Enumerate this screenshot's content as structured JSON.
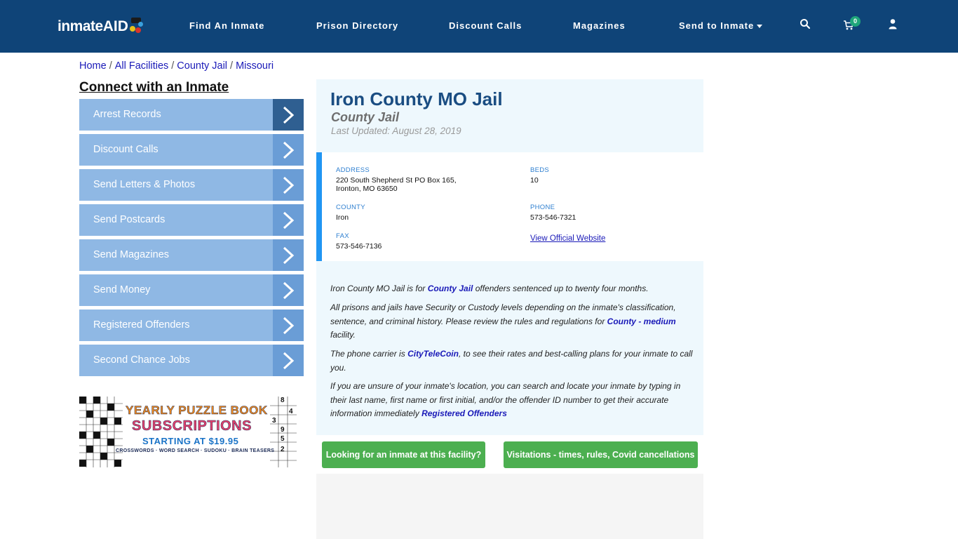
{
  "header": {
    "logo_text": "inmate",
    "logo_accent": "AID",
    "nav": [
      {
        "label": "Find An Inmate"
      },
      {
        "label": "Prison Directory"
      },
      {
        "label": "Discount Calls"
      },
      {
        "label": "Magazines"
      },
      {
        "label": "Send to Inmate"
      }
    ],
    "cart_count": "0",
    "icons": [
      "search-icon",
      "cart-icon",
      "user-icon",
      "chevron-down-icon"
    ]
  },
  "breadcrumb": {
    "items": [
      "Home",
      "All Facilities",
      "County Jail",
      "Missouri"
    ],
    "separator": "/"
  },
  "sidebar": {
    "title": "Connect with an Inmate",
    "items": [
      {
        "label": "Arrest Records"
      },
      {
        "label": "Discount Calls"
      },
      {
        "label": "Send Letters & Photos"
      },
      {
        "label": "Send Postcards"
      },
      {
        "label": "Send Magazines"
      },
      {
        "label": "Send Money"
      },
      {
        "label": "Registered Offenders"
      },
      {
        "label": "Second Chance Jobs"
      }
    ],
    "ad": {
      "line1": "YEARLY PUZZLE BOOK",
      "line2": "SUBSCRIPTIONS",
      "line3": "STARTING AT $19.95",
      "line4": "CROSSWORDS · WORD SEARCH · SUDOKU · BRAIN TEASERS",
      "grid_digits": [
        "8",
        "4",
        "3",
        "9",
        "5",
        "2"
      ]
    }
  },
  "facility": {
    "name": "Iron County MO Jail",
    "type": "County Jail",
    "updated": "Last Updated: August 28, 2019",
    "fields": {
      "address_label": "ADDRESS",
      "address_line1": "220 South Shepherd St PO Box 165,",
      "address_line2": "Ironton, MO 63650",
      "beds_label": "BEDS",
      "beds": "10",
      "county_label": "COUNTY",
      "county": "Iron",
      "phone_label": "PHONE",
      "phone": "573-546-7321",
      "fax_label": "FAX",
      "fax": "573-546-7136",
      "website_link": "View Official Website"
    },
    "desc": {
      "p1_pre": "Iron County MO Jail is for ",
      "p1_link": "County Jail",
      "p1_post": " offenders sentenced up to twenty four months.",
      "p2_pre": "All prisons and jails have Security or Custody levels depending on the inmate's classification, sentence, and criminal history. Please review the rules and regulations for ",
      "p2_link": "County - medium",
      "p2_post": " facility.",
      "p3_pre": "The phone carrier is ",
      "p3_link": "CityTeleCoin",
      "p3_post": ", to see their rates and best-calling plans for your inmate to call you.",
      "p4_pre": "If you are unsure of your inmate's location, you can search and locate your inmate by typing in their last name, first name or first initial, and/or the offender ID number to get their accurate information immediately ",
      "p4_link": "Registered Offenders"
    },
    "buttons": {
      "find_inmate": "Looking for an inmate at this facility?",
      "visitations": "Visitations - times, rules, Covid cancellations"
    }
  },
  "colors": {
    "header_bg": "#0f4478",
    "sidebar_item": "#8fb8e4",
    "sidebar_arrow": "#6a9dd6",
    "card_bg": "#eef8fd",
    "button_green": "#4caf50",
    "link_blue": "#1a1ab8",
    "accent_bar": "#2196f3"
  }
}
